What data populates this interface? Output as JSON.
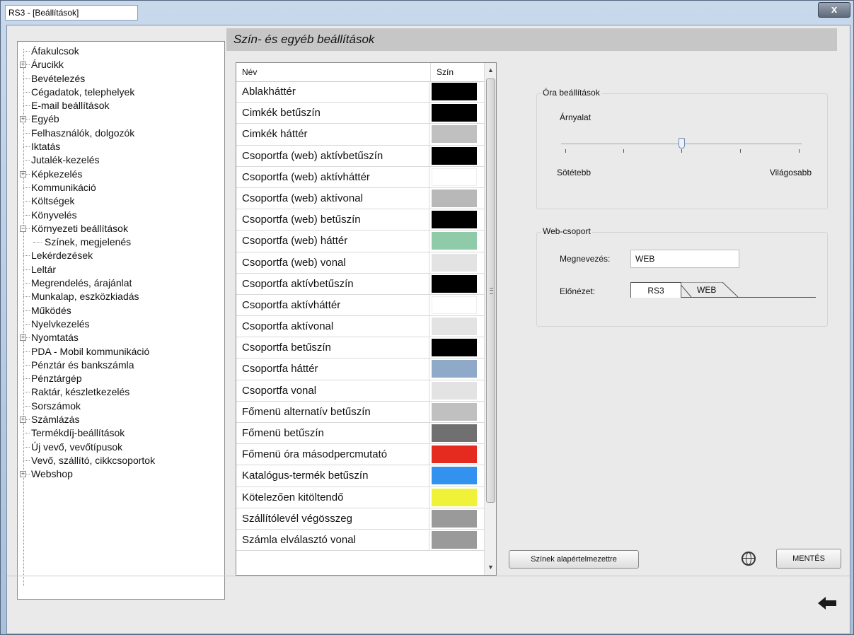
{
  "window": {
    "title": "RS3 - [Beállítások]",
    "close_label": "x"
  },
  "tree": {
    "items": [
      {
        "label": "Áfakulcsok",
        "expandable": false,
        "child": false
      },
      {
        "label": "Árucikk",
        "expandable": true,
        "child": false
      },
      {
        "label": "Bevételezés",
        "expandable": false,
        "child": false
      },
      {
        "label": "Cégadatok, telephelyek",
        "expandable": false,
        "child": false
      },
      {
        "label": "E-mail beállítások",
        "expandable": false,
        "child": false
      },
      {
        "label": "Egyéb",
        "expandable": true,
        "child": false
      },
      {
        "label": "Felhasználók, dolgozók",
        "expandable": false,
        "child": false
      },
      {
        "label": "Iktatás",
        "expandable": false,
        "child": false
      },
      {
        "label": "Jutalék-kezelés",
        "expandable": false,
        "child": false
      },
      {
        "label": "Képkezelés",
        "expandable": true,
        "child": false
      },
      {
        "label": "Kommunikáció",
        "expandable": false,
        "child": false
      },
      {
        "label": "Költségek",
        "expandable": false,
        "child": false
      },
      {
        "label": "Könyvelés",
        "expandable": false,
        "child": false
      },
      {
        "label": "Környezeti beállítások",
        "expandable": true,
        "expanded": true,
        "child": false
      },
      {
        "label": "Színek, megjelenés",
        "expandable": false,
        "child": true,
        "selected": true
      },
      {
        "label": "Lekérdezések",
        "expandable": false,
        "child": false
      },
      {
        "label": "Leltár",
        "expandable": false,
        "child": false
      },
      {
        "label": "Megrendelés, árajánlat",
        "expandable": false,
        "child": false
      },
      {
        "label": "Munkalap, eszközkiadás",
        "expandable": false,
        "child": false
      },
      {
        "label": "Működés",
        "expandable": false,
        "child": false
      },
      {
        "label": "Nyelvkezelés",
        "expandable": false,
        "child": false
      },
      {
        "label": "Nyomtatás",
        "expandable": true,
        "child": false
      },
      {
        "label": "PDA - Mobil kommunikáció",
        "expandable": false,
        "child": false
      },
      {
        "label": "Pénztár és bankszámla",
        "expandable": false,
        "child": false
      },
      {
        "label": "Pénztárgép",
        "expandable": false,
        "child": false
      },
      {
        "label": "Raktár, készletkezelés",
        "expandable": false,
        "child": false
      },
      {
        "label": "Sorszámok",
        "expandable": false,
        "child": false
      },
      {
        "label": "Számlázás",
        "expandable": true,
        "child": false
      },
      {
        "label": "Termékdíj-beállítások",
        "expandable": false,
        "child": false
      },
      {
        "label": "Új vevő, vevőtípusok",
        "expandable": false,
        "child": false
      },
      {
        "label": "Vevő, szállító, cikkcsoportok",
        "expandable": false,
        "child": false
      },
      {
        "label": "Webshop",
        "expandable": true,
        "child": false
      }
    ]
  },
  "header": {
    "title": "Szín- és egyéb beállítások"
  },
  "color_table": {
    "col_name": "Név",
    "col_color": "Szín",
    "rows": [
      {
        "name": "Ablakháttér",
        "color": "#000000"
      },
      {
        "name": "Cimkék betűszín",
        "color": "#000000"
      },
      {
        "name": "Cimkék háttér",
        "color": "#c0c0c0"
      },
      {
        "name": "Csoportfa (web) aktívbetűszín",
        "color": "#000000"
      },
      {
        "name": "Csoportfa (web) aktívháttér",
        "color": "#ffffff"
      },
      {
        "name": "Csoportfa (web) aktívonal",
        "color": "#b8b8b8"
      },
      {
        "name": "Csoportfa (web) betűszín",
        "color": "#000000"
      },
      {
        "name": "Csoportfa (web) háttér",
        "color": "#8fcba8"
      },
      {
        "name": "Csoportfa (web) vonal",
        "color": "#e3e3e3"
      },
      {
        "name": "Csoportfa aktívbetűszín",
        "color": "#000000"
      },
      {
        "name": "Csoportfa aktívháttér",
        "color": "#ffffff"
      },
      {
        "name": "Csoportfa aktívonal",
        "color": "#e3e3e3"
      },
      {
        "name": "Csoportfa betűszín",
        "color": "#000000"
      },
      {
        "name": "Csoportfa háttér",
        "color": "#8fa9c8"
      },
      {
        "name": "Csoportfa vonal",
        "color": "#e3e3e3"
      },
      {
        "name": "Főmenü alternatív betűszín",
        "color": "#c0c0c0"
      },
      {
        "name": "Főmenü betűszín",
        "color": "#707070"
      },
      {
        "name": "Főmenü óra másodpercmutató",
        "color": "#e52b1f"
      },
      {
        "name": "Katalógus-termék betűszín",
        "color": "#3392f0"
      },
      {
        "name": "Kötelezően kitöltendő",
        "color": "#f0f23a"
      },
      {
        "name": "Szállítólevél végösszeg",
        "color": "#9a9a9a"
      },
      {
        "name": "Számla elválasztó vonal",
        "color": "#9a9a9a"
      }
    ]
  },
  "clock_settings": {
    "group_title": "Óra beállítások",
    "shade_label": "Árnyalat",
    "left_label": "Sötétebb",
    "right_label": "Világosabb",
    "slider_value": 0.5
  },
  "web_group": {
    "group_title": "Web-csoport",
    "name_label": "Megnevezés:",
    "name_value": "WEB",
    "preview_label": "Előnézet:",
    "tab_rs3": "RS3",
    "tab_web": "WEB"
  },
  "buttons": {
    "defaults_label": "Színek alapértelmezettre",
    "save_label": "MENTÉS"
  }
}
